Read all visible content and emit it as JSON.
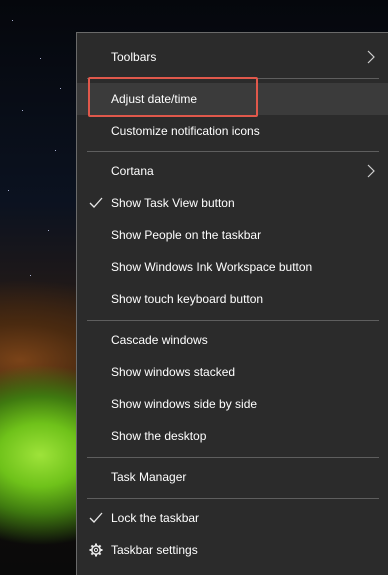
{
  "menu": {
    "items": [
      {
        "label": "Toolbars"
      },
      {
        "label": "Adjust date/time"
      },
      {
        "label": "Customize notification icons"
      },
      {
        "label": "Cortana"
      },
      {
        "label": "Show Task View button"
      },
      {
        "label": "Show People on the taskbar"
      },
      {
        "label": "Show Windows Ink Workspace button"
      },
      {
        "label": "Show touch keyboard button"
      },
      {
        "label": "Cascade windows"
      },
      {
        "label": "Show windows stacked"
      },
      {
        "label": "Show windows side by side"
      },
      {
        "label": "Show the desktop"
      },
      {
        "label": "Task Manager"
      },
      {
        "label": "Lock the taskbar"
      },
      {
        "label": "Taskbar settings"
      }
    ]
  },
  "highlight_color": "#e0584b",
  "menu_bg_color": "#2b2b2b",
  "icons": {
    "submenu": "chevron-right-icon",
    "checked": "checkmark-icon",
    "settings": "gear-icon"
  }
}
